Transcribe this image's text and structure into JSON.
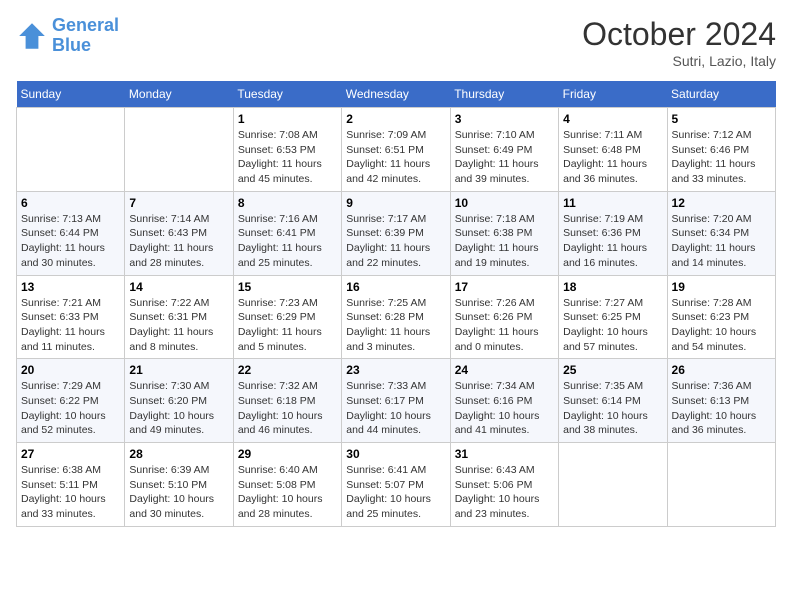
{
  "header": {
    "logo_line1": "General",
    "logo_line2": "Blue",
    "month": "October 2024",
    "location": "Sutri, Lazio, Italy"
  },
  "days_of_week": [
    "Sunday",
    "Monday",
    "Tuesday",
    "Wednesday",
    "Thursday",
    "Friday",
    "Saturday"
  ],
  "weeks": [
    [
      {
        "day": "",
        "sunrise": "",
        "sunset": "",
        "daylight": ""
      },
      {
        "day": "",
        "sunrise": "",
        "sunset": "",
        "daylight": ""
      },
      {
        "day": "1",
        "sunrise": "Sunrise: 7:08 AM",
        "sunset": "Sunset: 6:53 PM",
        "daylight": "Daylight: 11 hours and 45 minutes."
      },
      {
        "day": "2",
        "sunrise": "Sunrise: 7:09 AM",
        "sunset": "Sunset: 6:51 PM",
        "daylight": "Daylight: 11 hours and 42 minutes."
      },
      {
        "day": "3",
        "sunrise": "Sunrise: 7:10 AM",
        "sunset": "Sunset: 6:49 PM",
        "daylight": "Daylight: 11 hours and 39 minutes."
      },
      {
        "day": "4",
        "sunrise": "Sunrise: 7:11 AM",
        "sunset": "Sunset: 6:48 PM",
        "daylight": "Daylight: 11 hours and 36 minutes."
      },
      {
        "day": "5",
        "sunrise": "Sunrise: 7:12 AM",
        "sunset": "Sunset: 6:46 PM",
        "daylight": "Daylight: 11 hours and 33 minutes."
      }
    ],
    [
      {
        "day": "6",
        "sunrise": "Sunrise: 7:13 AM",
        "sunset": "Sunset: 6:44 PM",
        "daylight": "Daylight: 11 hours and 30 minutes."
      },
      {
        "day": "7",
        "sunrise": "Sunrise: 7:14 AM",
        "sunset": "Sunset: 6:43 PM",
        "daylight": "Daylight: 11 hours and 28 minutes."
      },
      {
        "day": "8",
        "sunrise": "Sunrise: 7:16 AM",
        "sunset": "Sunset: 6:41 PM",
        "daylight": "Daylight: 11 hours and 25 minutes."
      },
      {
        "day": "9",
        "sunrise": "Sunrise: 7:17 AM",
        "sunset": "Sunset: 6:39 PM",
        "daylight": "Daylight: 11 hours and 22 minutes."
      },
      {
        "day": "10",
        "sunrise": "Sunrise: 7:18 AM",
        "sunset": "Sunset: 6:38 PM",
        "daylight": "Daylight: 11 hours and 19 minutes."
      },
      {
        "day": "11",
        "sunrise": "Sunrise: 7:19 AM",
        "sunset": "Sunset: 6:36 PM",
        "daylight": "Daylight: 11 hours and 16 minutes."
      },
      {
        "day": "12",
        "sunrise": "Sunrise: 7:20 AM",
        "sunset": "Sunset: 6:34 PM",
        "daylight": "Daylight: 11 hours and 14 minutes."
      }
    ],
    [
      {
        "day": "13",
        "sunrise": "Sunrise: 7:21 AM",
        "sunset": "Sunset: 6:33 PM",
        "daylight": "Daylight: 11 hours and 11 minutes."
      },
      {
        "day": "14",
        "sunrise": "Sunrise: 7:22 AM",
        "sunset": "Sunset: 6:31 PM",
        "daylight": "Daylight: 11 hours and 8 minutes."
      },
      {
        "day": "15",
        "sunrise": "Sunrise: 7:23 AM",
        "sunset": "Sunset: 6:29 PM",
        "daylight": "Daylight: 11 hours and 5 minutes."
      },
      {
        "day": "16",
        "sunrise": "Sunrise: 7:25 AM",
        "sunset": "Sunset: 6:28 PM",
        "daylight": "Daylight: 11 hours and 3 minutes."
      },
      {
        "day": "17",
        "sunrise": "Sunrise: 7:26 AM",
        "sunset": "Sunset: 6:26 PM",
        "daylight": "Daylight: 11 hours and 0 minutes."
      },
      {
        "day": "18",
        "sunrise": "Sunrise: 7:27 AM",
        "sunset": "Sunset: 6:25 PM",
        "daylight": "Daylight: 10 hours and 57 minutes."
      },
      {
        "day": "19",
        "sunrise": "Sunrise: 7:28 AM",
        "sunset": "Sunset: 6:23 PM",
        "daylight": "Daylight: 10 hours and 54 minutes."
      }
    ],
    [
      {
        "day": "20",
        "sunrise": "Sunrise: 7:29 AM",
        "sunset": "Sunset: 6:22 PM",
        "daylight": "Daylight: 10 hours and 52 minutes."
      },
      {
        "day": "21",
        "sunrise": "Sunrise: 7:30 AM",
        "sunset": "Sunset: 6:20 PM",
        "daylight": "Daylight: 10 hours and 49 minutes."
      },
      {
        "day": "22",
        "sunrise": "Sunrise: 7:32 AM",
        "sunset": "Sunset: 6:18 PM",
        "daylight": "Daylight: 10 hours and 46 minutes."
      },
      {
        "day": "23",
        "sunrise": "Sunrise: 7:33 AM",
        "sunset": "Sunset: 6:17 PM",
        "daylight": "Daylight: 10 hours and 44 minutes."
      },
      {
        "day": "24",
        "sunrise": "Sunrise: 7:34 AM",
        "sunset": "Sunset: 6:16 PM",
        "daylight": "Daylight: 10 hours and 41 minutes."
      },
      {
        "day": "25",
        "sunrise": "Sunrise: 7:35 AM",
        "sunset": "Sunset: 6:14 PM",
        "daylight": "Daylight: 10 hours and 38 minutes."
      },
      {
        "day": "26",
        "sunrise": "Sunrise: 7:36 AM",
        "sunset": "Sunset: 6:13 PM",
        "daylight": "Daylight: 10 hours and 36 minutes."
      }
    ],
    [
      {
        "day": "27",
        "sunrise": "Sunrise: 6:38 AM",
        "sunset": "Sunset: 5:11 PM",
        "daylight": "Daylight: 10 hours and 33 minutes."
      },
      {
        "day": "28",
        "sunrise": "Sunrise: 6:39 AM",
        "sunset": "Sunset: 5:10 PM",
        "daylight": "Daylight: 10 hours and 30 minutes."
      },
      {
        "day": "29",
        "sunrise": "Sunrise: 6:40 AM",
        "sunset": "Sunset: 5:08 PM",
        "daylight": "Daylight: 10 hours and 28 minutes."
      },
      {
        "day": "30",
        "sunrise": "Sunrise: 6:41 AM",
        "sunset": "Sunset: 5:07 PM",
        "daylight": "Daylight: 10 hours and 25 minutes."
      },
      {
        "day": "31",
        "sunrise": "Sunrise: 6:43 AM",
        "sunset": "Sunset: 5:06 PM",
        "daylight": "Daylight: 10 hours and 23 minutes."
      },
      {
        "day": "",
        "sunrise": "",
        "sunset": "",
        "daylight": ""
      },
      {
        "day": "",
        "sunrise": "",
        "sunset": "",
        "daylight": ""
      }
    ]
  ]
}
